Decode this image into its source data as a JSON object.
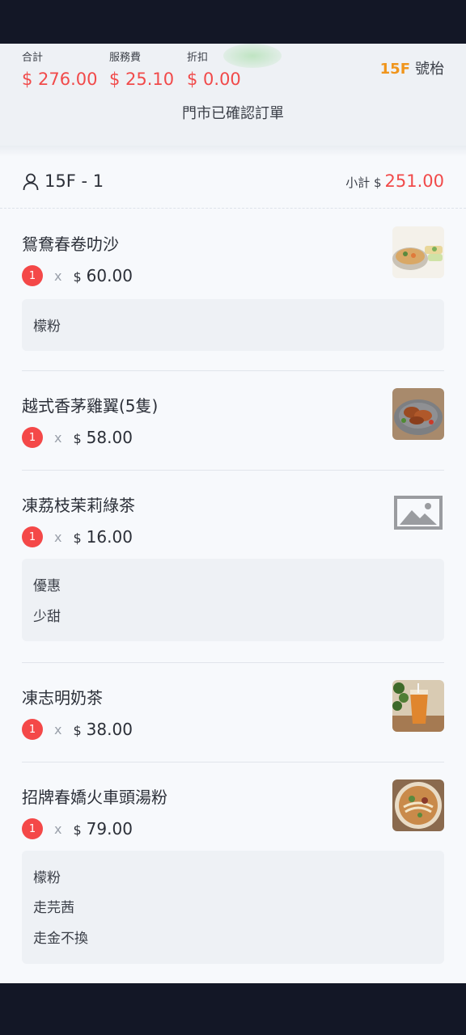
{
  "summary": {
    "total_label": "合計",
    "total_value": "$ 276.00",
    "service_label": "服務費",
    "service_value": "$ 25.10",
    "discount_label": "折扣",
    "discount_value": "$ 0.00",
    "floor": "15F",
    "number_label": "號枱",
    "status": "門市已確認訂單"
  },
  "table": {
    "name": "15F - 1",
    "subtotal_label": "小計 $",
    "subtotal_value": "251.00"
  },
  "items": [
    {
      "name": "鴛鴦春卷叻沙",
      "qty": "1",
      "times": "x",
      "currency": "$",
      "price": "60.00",
      "notes": [
        "檬粉"
      ],
      "thumb_icon": "laksa-dish-photo"
    },
    {
      "name": "越式香茅雞翼(5隻)",
      "qty": "1",
      "times": "x",
      "currency": "$",
      "price": "58.00",
      "notes": [],
      "thumb_icon": "chicken-wings-photo"
    },
    {
      "name": "凍荔枝茉莉綠茶",
      "qty": "1",
      "times": "x",
      "currency": "$",
      "price": "16.00",
      "notes": [
        "優惠",
        "少甜"
      ],
      "thumb_icon": "image-placeholder-icon"
    },
    {
      "name": "凍志明奶茶",
      "qty": "1",
      "times": "x",
      "currency": "$",
      "price": "38.00",
      "notes": [],
      "thumb_icon": "milk-tea-photo"
    },
    {
      "name": "招牌春嬌火車頭湯粉",
      "qty": "1",
      "times": "x",
      "currency": "$",
      "price": "79.00",
      "notes": [
        "檬粉",
        "走芫茜",
        "走金不換"
      ],
      "thumb_icon": "noodle-soup-photo"
    }
  ],
  "colors": {
    "accent_red": "#f14a4a",
    "floor_orange": "#f0951c",
    "badge_red": "#f44848"
  }
}
